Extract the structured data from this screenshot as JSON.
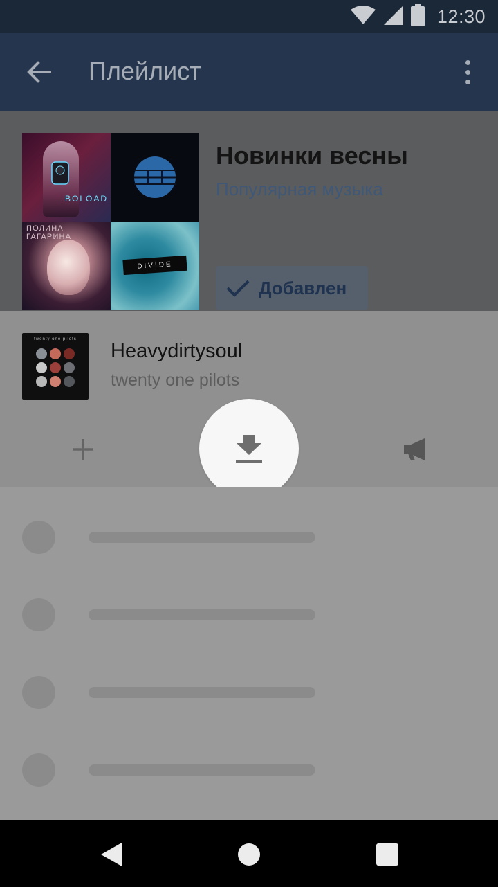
{
  "status_bar": {
    "time": "12:30",
    "icons": [
      "wifi-icon",
      "signal-icon",
      "battery-icon"
    ]
  },
  "toolbar": {
    "title": "Плейлист",
    "back_icon": "arrow-back-icon",
    "menu_icon": "more-vertical-icon"
  },
  "playlist": {
    "title": "Новинки весны",
    "subtitle": "Популярная музыка",
    "added_label": "Добавлен",
    "cover_texts": {
      "cover1": "BOLOAD",
      "cover3": "ПОЛИНА ГАГАРИНА",
      "cover4": "DIVIDE"
    }
  },
  "track": {
    "title": "Heavydirtysoul",
    "artist": "twenty one pilots",
    "cover_caption": "twenty one pilots"
  },
  "actions": {
    "add_icon": "plus-icon",
    "download_icon": "download-icon",
    "broadcast_icon": "megaphone-icon"
  },
  "skeleton_rows": 4,
  "nav": {
    "back_icon": "nav-back-icon",
    "home_icon": "nav-home-icon",
    "recents_icon": "nav-recents-icon"
  },
  "colors": {
    "status_bar": "#1b2838",
    "toolbar": "#24354d",
    "sheet": "#909090",
    "accent": "#3f5878"
  }
}
